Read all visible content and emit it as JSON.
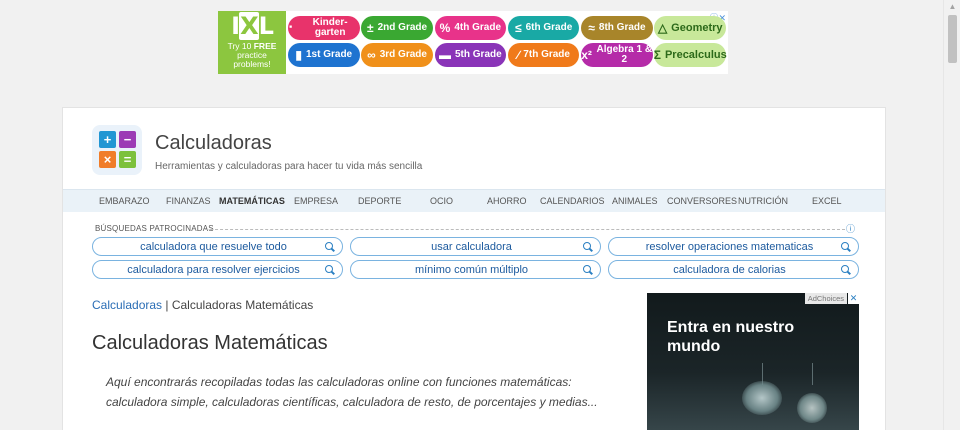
{
  "top_ad": {
    "brand": "IXL",
    "tagline_prefix": "Try 10",
    "tagline_bold": "FREE",
    "tagline_rest": "practice problems!",
    "close_label": "ⓘ✕",
    "grades": [
      {
        "icon": "⠂",
        "label": "Kinder- garten",
        "color": "#e8336b"
      },
      {
        "icon": "±",
        "label": "2nd Grade",
        "color": "#3aa832"
      },
      {
        "icon": "%",
        "label": "4th Grade",
        "color": "#e8338a"
      },
      {
        "icon": "≤",
        "label": "6th Grade",
        "color": "#19a9a5"
      },
      {
        "icon": "≈",
        "label": "8th Grade",
        "color": "#a8852a"
      },
      {
        "icon": "△",
        "label": "Geometry",
        "color": "#c8e89a"
      },
      {
        "icon": "▮",
        "label": "1st Grade",
        "color": "#1e73d0"
      },
      {
        "icon": "∞",
        "label": "3rd Grade",
        "color": "#f0901a"
      },
      {
        "icon": "▬",
        "label": "5th Grade",
        "color": "#8a34b8"
      },
      {
        "icon": "∕",
        "label": "7th Grade",
        "color": "#f07a1a"
      },
      {
        "icon": "x²",
        "label": "Algebra 1 & 2",
        "color": "#b52ba8"
      },
      {
        "icon": "Σ",
        "label": "Precalculus",
        "color": "#c8e89a"
      }
    ]
  },
  "site": {
    "title": "Calculadoras",
    "tagline": "Herramientas y calculadoras para hacer tu vida más sencilla",
    "logo_tiles": [
      {
        "symbol": "+",
        "color": "#2196d3"
      },
      {
        "symbol": "−",
        "color": "#9c3bb5"
      },
      {
        "symbol": "×",
        "color": "#f07d2a"
      },
      {
        "symbol": "=",
        "color": "#7cc13c"
      }
    ]
  },
  "nav": {
    "items": [
      {
        "label": "EMBARAZO",
        "active": false
      },
      {
        "label": "FINANZAS",
        "active": false
      },
      {
        "label": "MATEMÁTICAS",
        "active": true
      },
      {
        "label": "EMPRESA",
        "active": false
      },
      {
        "label": "DEPORTE",
        "active": false
      },
      {
        "label": "OCIO",
        "active": false
      },
      {
        "label": "AHORRO",
        "active": false
      },
      {
        "label": "CALENDARIOS",
        "active": false
      },
      {
        "label": "ANIMALES",
        "active": false
      },
      {
        "label": "CONVERSORES",
        "active": false
      },
      {
        "label": "NUTRICIÓN",
        "active": false
      },
      {
        "label": "EXCEL",
        "active": false
      }
    ]
  },
  "sponsored": {
    "label": "BÚSQUEDAS PATROCINADAS",
    "info": "ⓘ",
    "searches": [
      "calculadora que resuelve todo",
      "usar calculadora",
      "resolver operaciones matematicas",
      "calculadora para resolver ejercicios",
      "mínimo común múltiplo",
      "calculadora de calorias"
    ]
  },
  "breadcrumb": {
    "root": "Calculadoras",
    "separator": " | ",
    "current": "Calculadoras Matemáticas"
  },
  "page": {
    "heading": "Calculadoras Matemáticas",
    "intro": "Aquí encontrarás recopiladas todas las calculadoras online con funciones matemáticas: calculadora simple, calculadoras científicas, calculadora de resto, de porcentajes y medias..."
  },
  "side_ad": {
    "adchoices": "AdChoices",
    "close": "✕",
    "headline": "Entra en nuestro mundo"
  }
}
